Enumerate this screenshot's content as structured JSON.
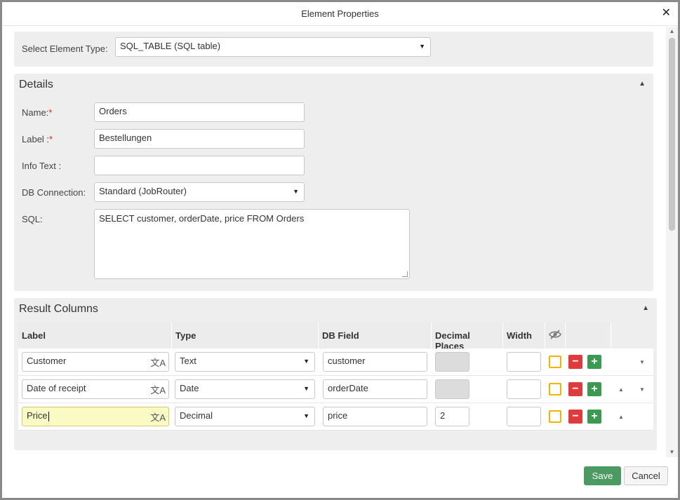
{
  "dialog": {
    "title": "Element Properties"
  },
  "type_select": {
    "label": "Select Element Type:",
    "value": "SQL_TABLE (SQL table)"
  },
  "details": {
    "title": "Details",
    "name_label": "Name:",
    "name_value": "Orders",
    "label_label": "Label :",
    "label_value": "Bestellungen",
    "info_label": "Info Text :",
    "info_value": "",
    "db_label": "DB Connection:",
    "db_value": "Standard (JobRouter)",
    "sql_label": "SQL:",
    "sql_value": "SELECT customer, orderDate, price FROM Orders",
    "required_mark": "*"
  },
  "columns": {
    "title": "Result Columns",
    "headers": [
      "Label",
      "Type",
      "DB Field",
      "Decimal Places",
      "Width"
    ],
    "rows": [
      {
        "label": "Customer",
        "type": "Text",
        "db_field": "customer",
        "decimals": "",
        "width": ""
      },
      {
        "label": "Date of receipt",
        "type": "Date",
        "db_field": "orderDate",
        "decimals": "",
        "width": ""
      },
      {
        "label": "Price",
        "type": "Decimal",
        "db_field": "price",
        "decimals": "2",
        "width": ""
      }
    ]
  },
  "footer": {
    "save": "Save",
    "cancel": "Cancel"
  },
  "colors": {
    "accent": "#4a9a62",
    "remove": "#e03b3b",
    "checkbox": "#f0b400"
  }
}
